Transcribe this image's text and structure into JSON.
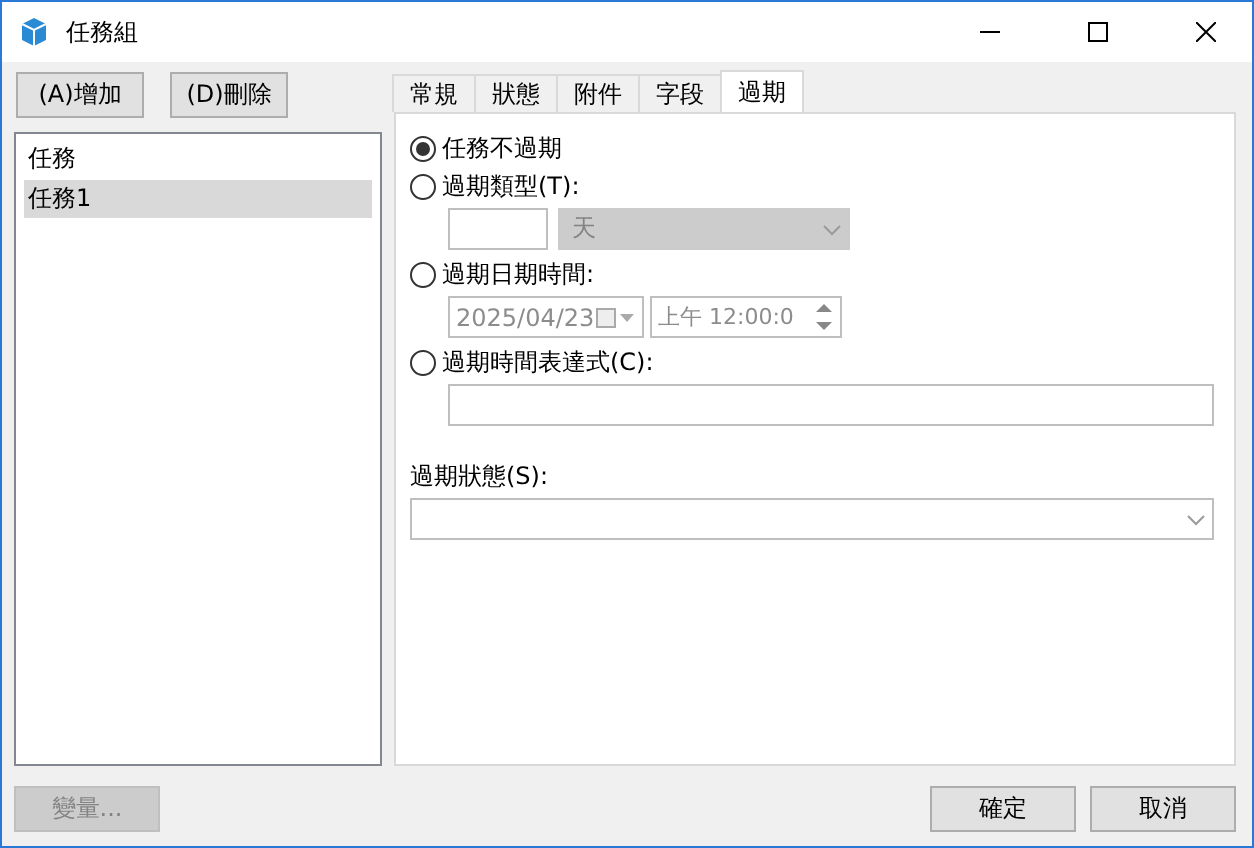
{
  "window": {
    "title": "任務組"
  },
  "toolbar": [
    {
      "label": "(A)增加"
    },
    {
      "label": "(D)刪除"
    }
  ],
  "list": [
    {
      "label": "任務",
      "selected": false
    },
    {
      "label": "任務1",
      "selected": true
    }
  ],
  "tabs": [
    {
      "label": "常規",
      "selected": false
    },
    {
      "label": "狀態",
      "selected": false
    },
    {
      "label": "附件",
      "selected": false
    },
    {
      "label": "字段",
      "selected": false
    },
    {
      "label": "過期",
      "selected": true
    }
  ],
  "options": [
    {
      "kind": "none",
      "label": "任務不過期",
      "selected": true
    },
    {
      "kind": "type",
      "label": "過期類型(T):",
      "selected": false,
      "unit": {
        "value": "天",
        "disabled": true
      }
    },
    {
      "kind": "datetime",
      "label": "過期日期時間:",
      "selected": false,
      "date": "2025/04/23",
      "time": "上午 12:00:0",
      "disabled": true
    },
    {
      "kind": "expression",
      "label": "過期時間表達式(C):",
      "selected": false
    }
  ],
  "status": {
    "label": "過期狀態(S):"
  },
  "footer": {
    "left": [
      {
        "label": "變量...",
        "disabled": true
      }
    ],
    "right": [
      {
        "label": "確定",
        "disabled": false
      },
      {
        "label": "取消",
        "disabled": false
      }
    ]
  }
}
